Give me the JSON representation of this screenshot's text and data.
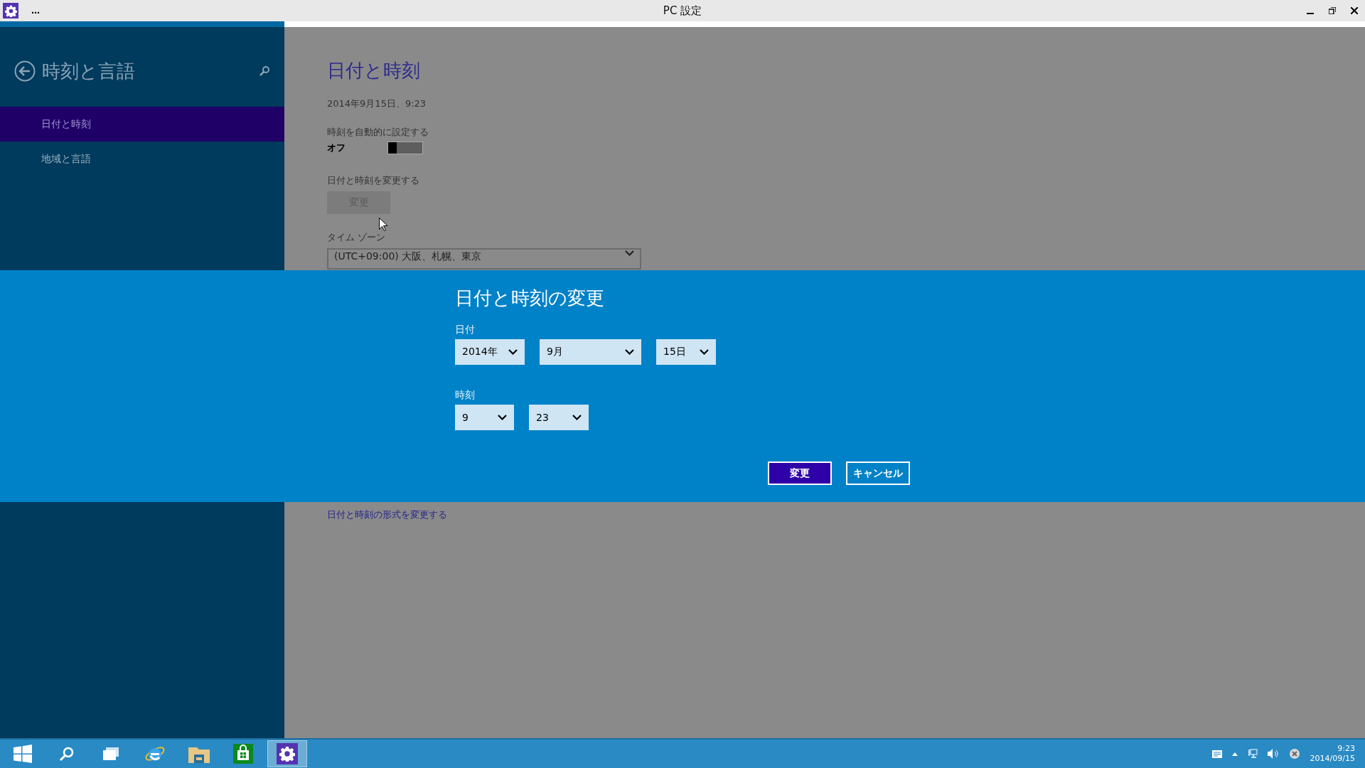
{
  "window": {
    "title": "PC 設定",
    "menu_glyph": "…"
  },
  "sidebar": {
    "title": "時刻と言語",
    "items": [
      {
        "label": "日付と時刻",
        "selected": true
      },
      {
        "label": "地域と言語",
        "selected": false
      }
    ]
  },
  "main": {
    "heading": "日付と時刻",
    "current_datetime": "2014年9月15日、9:23",
    "auto_time": {
      "label": "時刻を自動的に設定する",
      "state_text": "オフ",
      "on": false
    },
    "change": {
      "label": "日付と時刻を変更する",
      "button": "変更"
    },
    "timezone": {
      "label": "タイム ゾーン",
      "value": "(UTC+09:00) 大阪、札幌、東京"
    },
    "format_link": "日付と時刻の形式を変更する"
  },
  "dialog": {
    "title": "日付と時刻の変更",
    "date": {
      "label": "日付",
      "fields": [
        {
          "value": "2014年",
          "kind": "year"
        },
        {
          "value": "9月",
          "kind": "month"
        },
        {
          "value": "15日",
          "kind": "day"
        }
      ]
    },
    "time": {
      "label": "時刻",
      "fields": [
        {
          "value": "9",
          "kind": "hour"
        },
        {
          "value": "23",
          "kind": "minute"
        }
      ]
    },
    "buttons": [
      {
        "label": "変更",
        "kind": "primary"
      },
      {
        "label": "キャンセル",
        "kind": "secondary"
      }
    ]
  },
  "taskbar": {
    "apps": [
      {
        "kind": "start",
        "active": false
      },
      {
        "kind": "search",
        "active": false
      },
      {
        "kind": "taskview",
        "active": false
      },
      {
        "kind": "browser",
        "active": false
      },
      {
        "kind": "folder",
        "active": false
      },
      {
        "kind": "store",
        "active": false
      },
      {
        "kind": "settings",
        "active": true
      }
    ],
    "time": "9:23",
    "date": "2014/09/15"
  }
}
